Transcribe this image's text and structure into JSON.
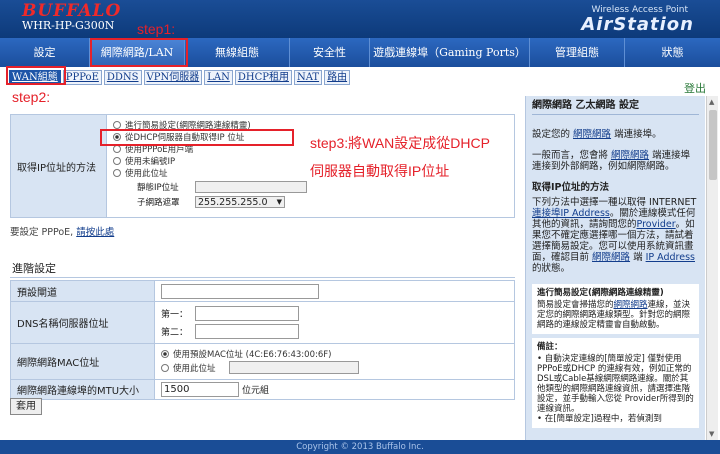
{
  "header": {
    "logo": "BUFFALO",
    "model": "WHR-HP-G300N",
    "product_label": "Wireless Access Point",
    "product_name": "AirStation"
  },
  "main_nav": [
    "設定",
    "網際網路/LAN",
    "無線組態",
    "安全性",
    "遊戲連線埠（Gaming Ports）",
    "管理組態",
    "狀態"
  ],
  "sub_nav": [
    "WAN組態",
    "PPPoE",
    "DDNS",
    "VPN伺服器",
    "LAN",
    "DHCP租用",
    "NAT",
    "路由"
  ],
  "logout": "登出",
  "annotations": {
    "step1": "step1:",
    "step2": "step2:",
    "step3_line1": "step3:將WAN設定成從DHCP",
    "step3_line2": "伺服器自動取得IP位址"
  },
  "wan": {
    "label": "取得IP位址的方法",
    "options": [
      "進行簡易設定(網際網路連線精靈)",
      "從DHCP伺服器自動取得IP 位址",
      "使用PPPoE用戶端",
      "使用未編號IP",
      "使用此位址"
    ],
    "selected_index": 1,
    "static_ip_label": "靜態IP位址",
    "static_ip_value": "",
    "subnet_label": "子網路遮罩",
    "subnet_value": "255.255.255.0"
  },
  "ppoe": {
    "text": "要設定 PPPoE, ",
    "link": "請按此處"
  },
  "advanced": {
    "title": "進階設定",
    "gateway_label": "預設閘道",
    "gateway_value": "",
    "dns_label": "DNS名稱伺服器位址",
    "dns_primary_label": "第一：",
    "dns_primary_value": "",
    "dns_secondary_label": "第二：",
    "dns_secondary_value": "",
    "mac_label": "網際網路MAC位址",
    "mac_default": "使用預設MAC位址 (4C:E6:76:43:00:6F)",
    "mac_custom": "使用此位址",
    "mac_custom_value": "",
    "mtu_label": "網際網路連線埠的MTU大小",
    "mtu_value": "1500",
    "mtu_unit": "位元組",
    "apply": "套用"
  },
  "help": {
    "title": "網際網路 乙太網路 設定",
    "p1_a": "設定您的 ",
    "p1_link": "網際網路",
    "p1_b": " 端連接埠。",
    "p2_a": "一般而言，您會將 ",
    "p2_link": "網際網路",
    "p2_b": " 端連接埠連接到外部網路，例如網際網路。",
    "sub1": "取得IP位址的方法",
    "p3_a": "下列方法中選擇一種以取得 INTERNET ",
    "p3_link1": "連接埠IP Address",
    "p3_b": "。關於連線模式任何其他的資訊，請詢問您的",
    "p3_link2": "Provider",
    "p3_c": "。如果您不確定應選擇哪一個方法，請試着選擇簡易設定。您可以使用系統資訊畫面，確認目前 ",
    "p3_link3": "網際網路",
    "p3_d": " 端 ",
    "p3_link4": "IP Address",
    "p3_e": " 的狀態。",
    "card1_title": "進行簡易設定(網際網路連線精靈)",
    "card1_a": "簡易設定會掃描您的",
    "card1_link": "網際網路",
    "card1_b": "連線，並決定您的網際網路連線類型。針對您的網際網路的連線設定精靈會自動啟動。",
    "card2_title": "備註：",
    "card2_text": "• 自動決定連線的[簡單設定] 僅對使用PPPoE或DHCP 的連線有效，例如正常的DSL或Cable基線網際網路連線。關於其他類型的網際網路連線資訊，請選擇進階設定，並手動輸入您從 Provider所得到的連線資訊。",
    "card2_more": "• 在[簡單設定]過程中，若偵測到"
  },
  "footer": "Copyright © 2013 Buffalo Inc."
}
